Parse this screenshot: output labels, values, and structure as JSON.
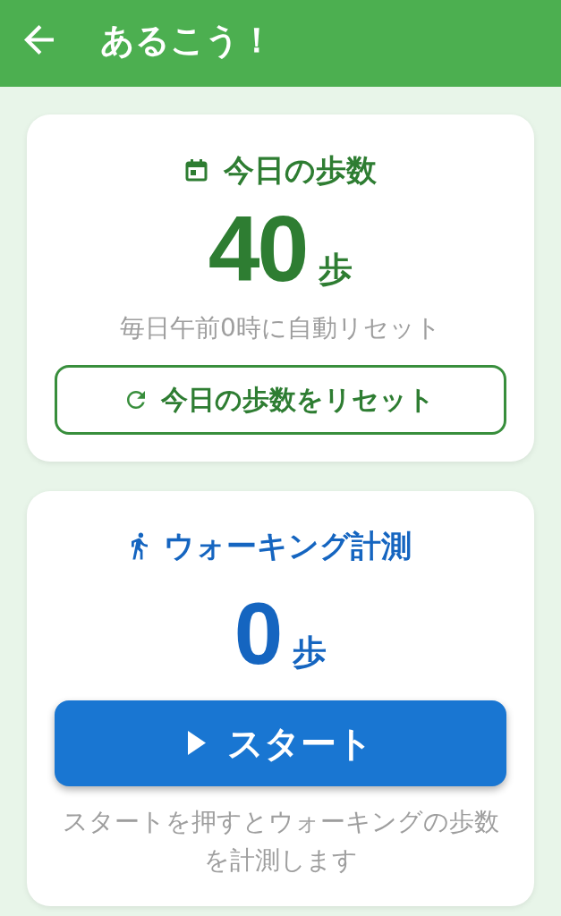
{
  "app_bar": {
    "title": "あるこう！"
  },
  "cards": [
    {
      "kind": "daily",
      "title": "今日の歩数",
      "count": "40",
      "unit": "歩",
      "note": "毎日午前0時に自動リセット",
      "button": "今日の歩数をリセット"
    },
    {
      "kind": "walking",
      "title": "ウォーキング計測",
      "count": "0",
      "unit": "歩",
      "button": "スタート",
      "note": "スタートを押すとウォーキングの歩数を計測します"
    }
  ]
}
